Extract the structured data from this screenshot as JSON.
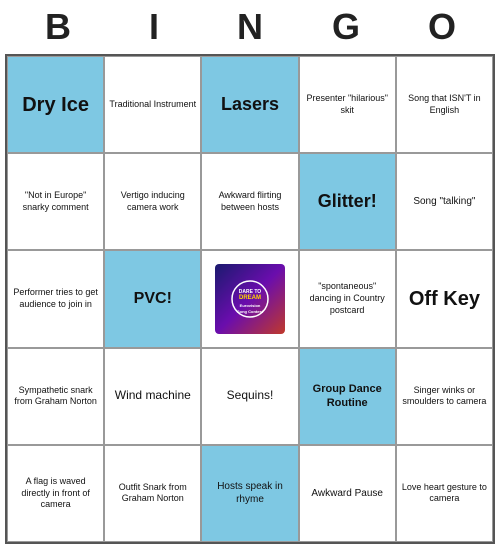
{
  "title": {
    "letters": [
      "B",
      "I",
      "N",
      "G",
      "O"
    ]
  },
  "cells": [
    {
      "text": "Dry Ice",
      "type": "highlight",
      "row": 0,
      "col": 0
    },
    {
      "text": "Traditional Instrument",
      "type": "normal",
      "row": 0,
      "col": 1
    },
    {
      "text": "Lasers",
      "type": "highlight",
      "row": 0,
      "col": 2
    },
    {
      "text": "Presenter \"hilarious\" skit",
      "type": "normal",
      "row": 0,
      "col": 3
    },
    {
      "text": "Song that ISN'T in English",
      "type": "normal",
      "row": 0,
      "col": 4
    },
    {
      "text": "\"Not in Europe\" snarky comment",
      "type": "normal",
      "row": 1,
      "col": 0
    },
    {
      "text": "Vertigo inducing camera work",
      "type": "normal",
      "row": 1,
      "col": 1
    },
    {
      "text": "Awkward flirting between hosts",
      "type": "normal",
      "row": 1,
      "col": 2
    },
    {
      "text": "Glitter!",
      "type": "highlight",
      "row": 1,
      "col": 3
    },
    {
      "text": "Song \"talking\"",
      "type": "normal",
      "row": 1,
      "col": 4
    },
    {
      "text": "Performer tries to get audience to join in",
      "type": "normal",
      "row": 2,
      "col": 0
    },
    {
      "text": "PVC!",
      "type": "highlight",
      "row": 2,
      "col": 1
    },
    {
      "text": "EUROVISION_LOGO",
      "type": "logo",
      "row": 2,
      "col": 2
    },
    {
      "text": "\"spontaneous\" dancing in Country postcard",
      "type": "normal",
      "row": 2,
      "col": 3
    },
    {
      "text": "Off Key",
      "type": "normal",
      "row": 2,
      "col": 4
    },
    {
      "text": "Sympathetic snark from Graham Norton",
      "type": "normal",
      "row": 3,
      "col": 0
    },
    {
      "text": "Wind machine",
      "type": "normal",
      "row": 3,
      "col": 1
    },
    {
      "text": "Sequins!",
      "type": "normal",
      "row": 3,
      "col": 2
    },
    {
      "text": "Group Dance Routine",
      "type": "highlight",
      "row": 3,
      "col": 3
    },
    {
      "text": "Singer winks or smoulders to camera",
      "type": "normal",
      "row": 3,
      "col": 4
    },
    {
      "text": "A flag is waved directly in front of camera",
      "type": "normal",
      "row": 4,
      "col": 0
    },
    {
      "text": "Outfit Snark from Graham Norton",
      "type": "normal",
      "row": 4,
      "col": 1
    },
    {
      "text": "Hosts speak in rhyme",
      "type": "highlight",
      "row": 4,
      "col": 2
    },
    {
      "text": "Awkward Pause",
      "type": "normal",
      "row": 4,
      "col": 3
    },
    {
      "text": "Love heart gesture to camera",
      "type": "normal",
      "row": 4,
      "col": 4
    }
  ]
}
